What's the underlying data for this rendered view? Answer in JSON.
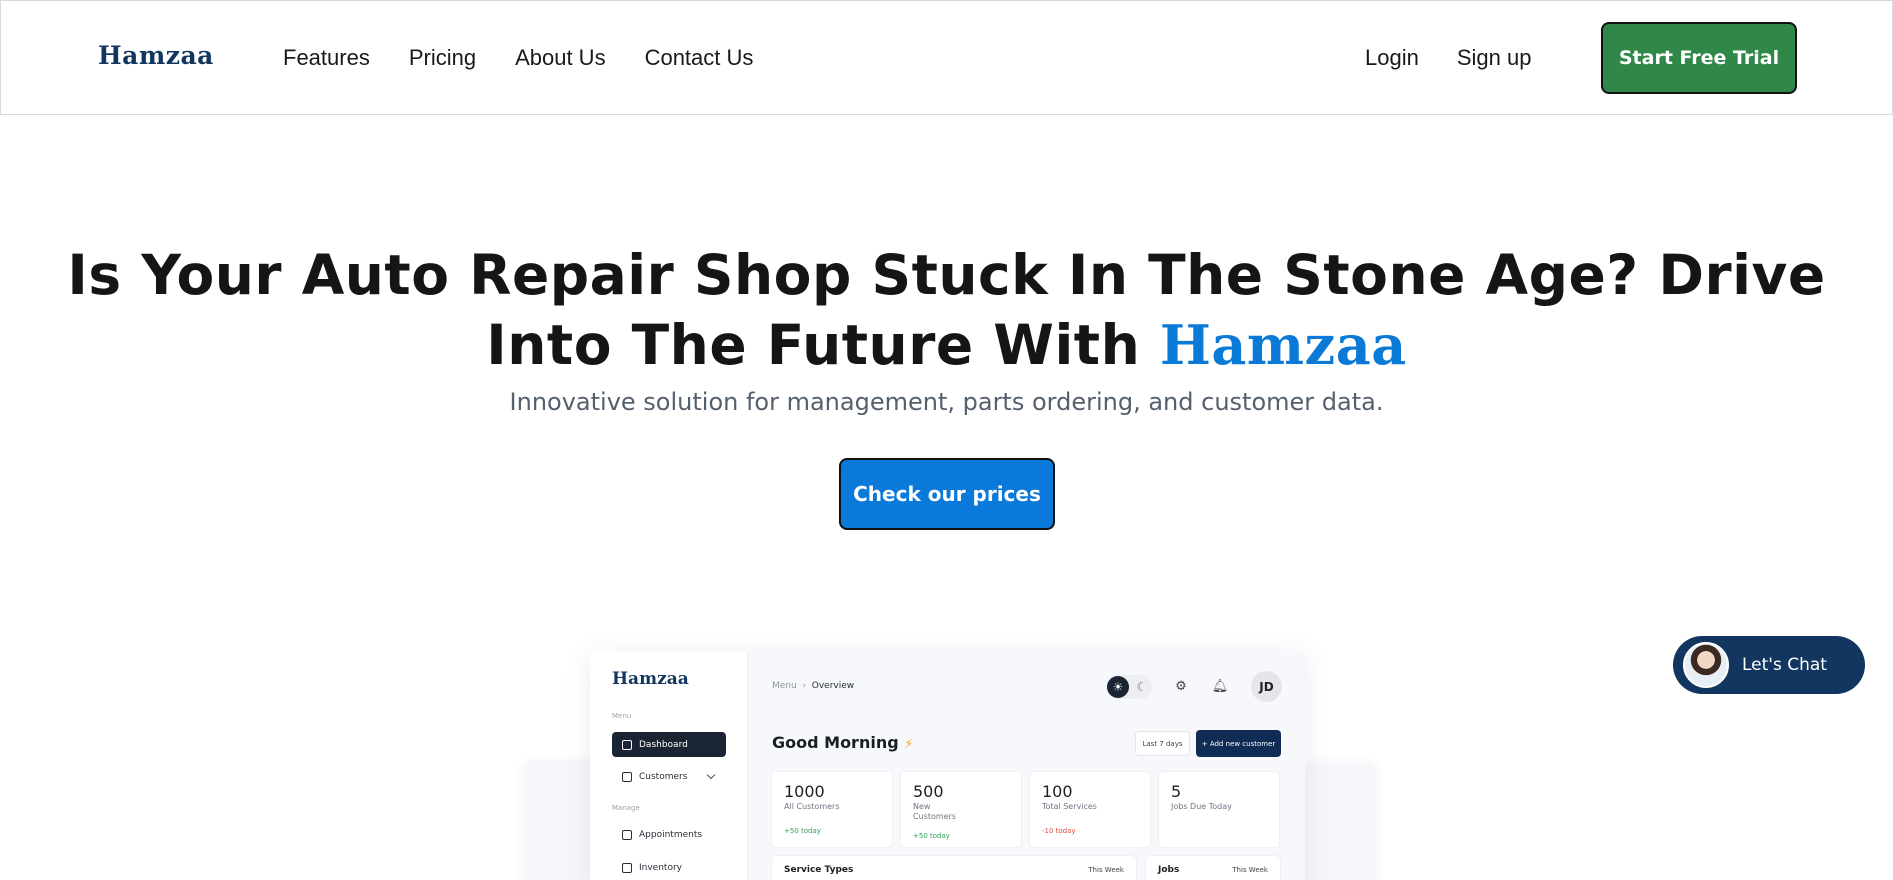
{
  "nav": {
    "logo": "Hamzaa",
    "links": [
      "Features",
      "Pricing",
      "About Us",
      "Contact Us"
    ],
    "login": "Login",
    "signup": "Sign up",
    "cta": "Start Free Trial"
  },
  "hero": {
    "title_line1": "Is Your Auto Repair Shop Stuck In The Stone Age? Drive",
    "title_line2": "Into The Future With",
    "brand": "Hamzaa",
    "subtitle": "Innovative solution for management, parts ordering, and customer data.",
    "cta": "Check our prices"
  },
  "dashboard": {
    "logo": "Hamzaa",
    "menu_label": "Menu",
    "manage_label": "Manage",
    "items": [
      "Dashboard",
      "Customers",
      "Appointments",
      "Inventory"
    ],
    "breadcrumb_root": "Menu",
    "breadcrumb_current": "Overview",
    "avatar_initials": "JD",
    "greeting": "Good Morning",
    "range": "Last 7 days",
    "add_button": "Add new customer",
    "stats": [
      {
        "value": "1000",
        "label": "All Customers",
        "delta": "+50 today",
        "trend": "up"
      },
      {
        "value": "500",
        "label": "New Customers",
        "delta": "+50 today",
        "trend": "up"
      },
      {
        "value": "100",
        "label": "Total Services",
        "delta": "-10 today",
        "trend": "down"
      },
      {
        "value": "5",
        "label": "Jobs Due Today",
        "delta": "",
        "trend": ""
      }
    ],
    "panels": [
      {
        "title": "Service Types",
        "range": "This Week"
      },
      {
        "title": "Jobs",
        "range": "This Week"
      }
    ]
  },
  "chat": {
    "label": "Let's Chat"
  },
  "colors": {
    "primary_blue": "#0a79d9",
    "navy": "#12365f",
    "green": "#2f8847"
  }
}
